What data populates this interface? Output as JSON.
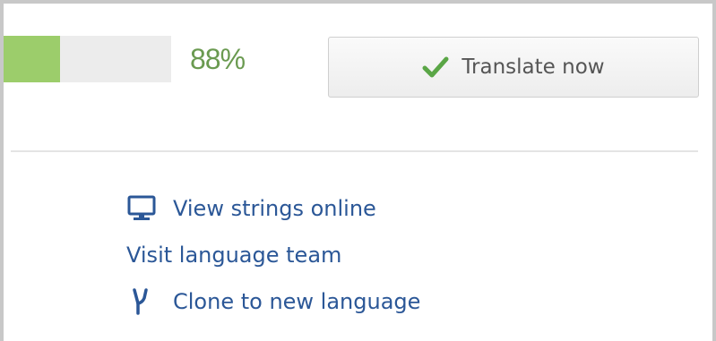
{
  "progress": {
    "percent": 88,
    "label": "88%",
    "fill_color": "#9ccd6b",
    "track_color": "#ececec",
    "label_color": "#6a9a50"
  },
  "translate_button": {
    "label": "Translate now",
    "icon": "checkmark-icon",
    "icon_color": "#5aa646"
  },
  "links": {
    "view_strings": {
      "label": "View strings online",
      "icon": "monitor-icon"
    },
    "visit_team": {
      "label": "Visit language team"
    },
    "clone": {
      "label": "Clone to new language",
      "icon": "fork-icon"
    },
    "color": "#2b5797"
  }
}
